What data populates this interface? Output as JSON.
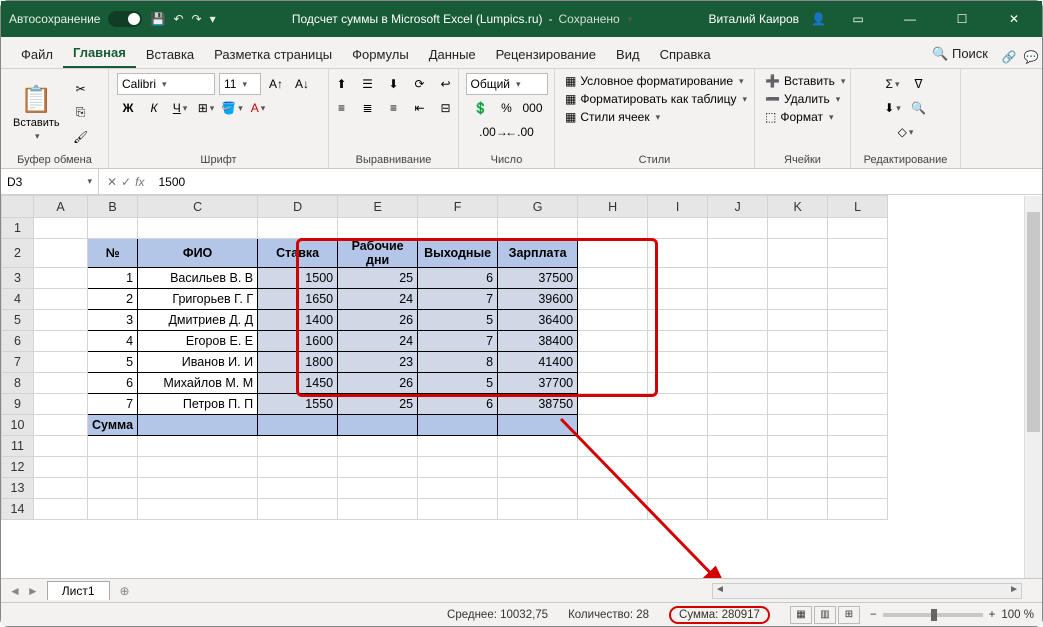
{
  "title": {
    "autosave": "Автосохранение",
    "doc": "Подсчет суммы в Microsoft Excel (Lumpics.ru)",
    "saved": "Сохранено",
    "user": "Виталий Каиров"
  },
  "tabs": [
    "Файл",
    "Главная",
    "Вставка",
    "Разметка страницы",
    "Формулы",
    "Данные",
    "Рецензирование",
    "Вид",
    "Справка"
  ],
  "search": "Поиск",
  "ribbon": {
    "clipboard": {
      "paste": "Вставить",
      "label": "Буфер обмена"
    },
    "font": {
      "name": "Calibri",
      "size": "11",
      "label": "Шрифт"
    },
    "align": {
      "label": "Выравнивание"
    },
    "number": {
      "format": "Общий",
      "label": "Число"
    },
    "styles": {
      "cond": "Условное форматирование",
      "table": "Форматировать как таблицу",
      "cell": "Стили ячеек",
      "label": "Стили"
    },
    "cells": {
      "insert": "Вставить",
      "delete": "Удалить",
      "format": "Формат",
      "label": "Ячейки"
    },
    "editing": {
      "label": "Редактирование"
    }
  },
  "namebox": "D3",
  "formula": "1500",
  "cols": [
    "A",
    "B",
    "C",
    "D",
    "E",
    "F",
    "G",
    "H",
    "I",
    "J",
    "K",
    "L"
  ],
  "rows": [
    "1",
    "2",
    "3",
    "4",
    "5",
    "6",
    "7",
    "8",
    "9",
    "10",
    "11",
    "12",
    "13",
    "14"
  ],
  "headers": {
    "num": "№",
    "fio": "ФИО",
    "rate": "Ставка",
    "days": "Рабочие дни",
    "week": "Выходные",
    "sal": "Зарплата"
  },
  "data": [
    {
      "n": "1",
      "fio": "Васильев В. В",
      "rate": "1500",
      "days": "25",
      "week": "6",
      "sal": "37500"
    },
    {
      "n": "2",
      "fio": "Григорьев Г. Г",
      "rate": "1650",
      "days": "24",
      "week": "7",
      "sal": "39600"
    },
    {
      "n": "3",
      "fio": "Дмитриев Д. Д",
      "rate": "1400",
      "days": "26",
      "week": "5",
      "sal": "36400"
    },
    {
      "n": "4",
      "fio": "Егоров Е. Е",
      "rate": "1600",
      "days": "24",
      "week": "7",
      "sal": "38400"
    },
    {
      "n": "5",
      "fio": "Иванов И. И",
      "rate": "1800",
      "days": "23",
      "week": "8",
      "sal": "41400"
    },
    {
      "n": "6",
      "fio": "Михайлов М. М",
      "rate": "1450",
      "days": "26",
      "week": "5",
      "sal": "37700"
    },
    {
      "n": "7",
      "fio": "Петров П. П",
      "rate": "1550",
      "days": "25",
      "week": "6",
      "sal": "38750"
    }
  ],
  "sumlabel": "Сумма",
  "sheet": "Лист1",
  "status": {
    "avg": "Среднее: 10032,75",
    "count": "Количество: 28",
    "sum": "Сумма: 280917",
    "zoom": "100 %"
  }
}
